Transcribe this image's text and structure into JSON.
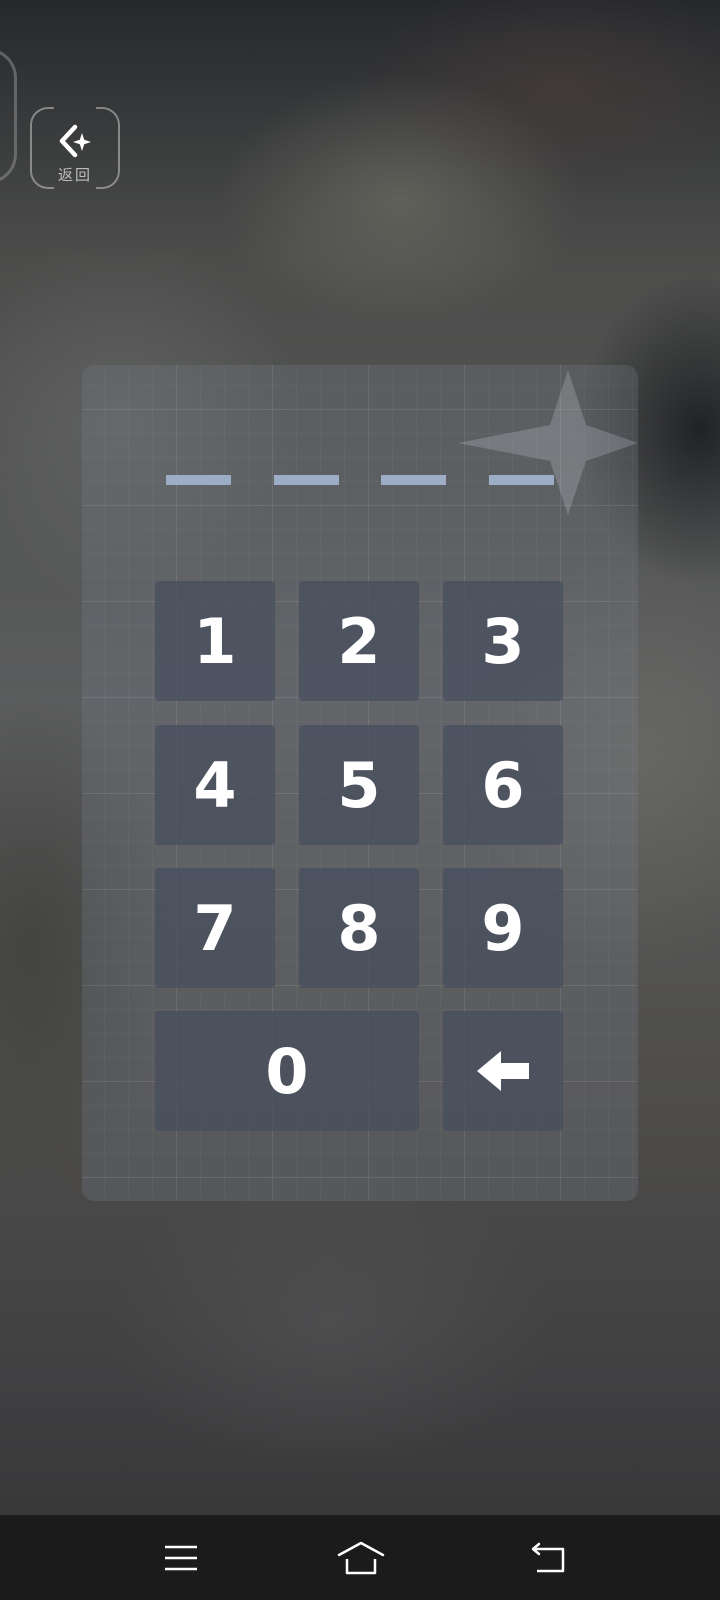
{
  "header": {
    "back_label": "返回"
  },
  "pin": {
    "length": 4,
    "entered": 0
  },
  "keypad": {
    "keys": [
      "1",
      "2",
      "3",
      "4",
      "5",
      "6",
      "7",
      "8",
      "9",
      "0"
    ],
    "backspace_icon": "left-arrow-icon"
  },
  "navbar": {
    "items": [
      "menu-icon",
      "home-icon",
      "back-icon"
    ]
  },
  "colors": {
    "pin_slot": "#9eadc6",
    "key_bg": "#484e5e",
    "key_text": "#ffffff",
    "navbar_bg": "#1b1b1c"
  }
}
